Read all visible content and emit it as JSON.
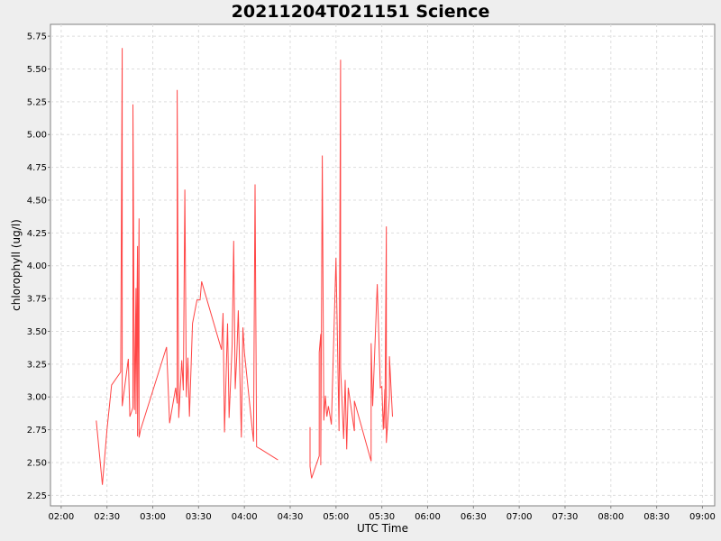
{
  "chart_data": {
    "type": "line",
    "title": "20211204T021151 Science",
    "xlabel": "UTC Time",
    "ylabel": "chlorophyll (ug/l)",
    "x_ticks": [
      "02:00",
      "02:30",
      "03:00",
      "03:30",
      "04:00",
      "04:30",
      "05:00",
      "05:30",
      "06:00",
      "06:30",
      "07:00",
      "07:30",
      "08:00",
      "08:30",
      "09:00"
    ],
    "y_ticks": [
      "2.25",
      "2.50",
      "2.75",
      "3.00",
      "3.25",
      "3.50",
      "3.75",
      "4.00",
      "4.25",
      "4.50",
      "4.75",
      "5.00",
      "5.25",
      "5.50",
      "5.75"
    ],
    "xlim": [
      "01:53",
      "09:08"
    ],
    "ylim": [
      2.17,
      5.84
    ],
    "grid": true,
    "series_color": "#ff4444",
    "series": [
      {
        "segments": [
          [
            [
              "02:23",
              2.82
            ],
            [
              "02:27",
              2.33
            ],
            [
              "02:30",
              2.75
            ],
            [
              "02:33",
              3.09
            ],
            [
              "02:39",
              3.19
            ],
            [
              "02:40",
              5.66
            ],
            [
              "02:40",
              2.93
            ],
            [
              "02:44",
              3.29
            ],
            [
              "02:45",
              2.85
            ],
            [
              "02:47",
              2.92
            ],
            [
              "02:47",
              5.23
            ],
            [
              "02:48",
              2.9
            ],
            [
              "02:49",
              3.83
            ],
            [
              "02:49",
              2.87
            ],
            [
              "02:50",
              4.15
            ],
            [
              "02:50",
              2.7
            ],
            [
              "02:51",
              4.36
            ],
            [
              "02:51",
              2.69
            ],
            [
              "02:52",
              2.75
            ],
            [
              "03:09",
              3.38
            ],
            [
              "03:11",
              2.8
            ],
            [
              "03:15",
              3.07
            ],
            [
              "03:16",
              2.95
            ],
            [
              "03:16",
              5.34
            ],
            [
              "03:17",
              2.84
            ],
            [
              "03:19",
              3.28
            ],
            [
              "03:20",
              3.05
            ],
            [
              "03:21",
              4.58
            ],
            [
              "03:22",
              3.0
            ],
            [
              "03:23",
              3.3
            ],
            [
              "03:24",
              2.85
            ],
            [
              "03:26",
              3.56
            ],
            [
              "03:29",
              3.74
            ],
            [
              "03:31",
              3.74
            ],
            [
              "03:32",
              3.88
            ],
            [
              "03:45",
              3.36
            ],
            [
              "03:46",
              3.64
            ],
            [
              "03:47",
              2.73
            ],
            [
              "03:49",
              3.56
            ],
            [
              "03:50",
              2.84
            ],
            [
              "03:52",
              3.4
            ],
            [
              "03:53",
              4.19
            ],
            [
              "03:54",
              3.06
            ],
            [
              "03:55",
              3.31
            ],
            [
              "03:56",
              3.66
            ],
            [
              "03:58",
              2.69
            ],
            [
              "03:59",
              3.53
            ],
            [
              "04:00",
              3.34
            ],
            [
              "04:06",
              2.66
            ],
            [
              "04:07",
              4.62
            ],
            [
              "04:08",
              2.62
            ],
            [
              "04:11",
              2.6
            ],
            [
              "04:22",
              2.52
            ]
          ],
          [
            [
              "04:43",
              2.77
            ],
            [
              "04:43",
              2.47
            ],
            [
              "04:44",
              2.38
            ],
            [
              "04:49",
              2.55
            ],
            [
              "04:49",
              3.34
            ],
            [
              "04:50",
              3.48
            ],
            [
              "04:50",
              2.48
            ],
            [
              "04:51",
              4.84
            ],
            [
              "04:52",
              2.82
            ],
            [
              "04:53",
              3.01
            ],
            [
              "04:54",
              2.85
            ],
            [
              "04:55",
              2.93
            ],
            [
              "04:57",
              2.79
            ],
            [
              "05:00",
              4.06
            ],
            [
              "05:02",
              2.74
            ],
            [
              "05:03",
              5.57
            ],
            [
              "05:03",
              3.22
            ],
            [
              "05:05",
              2.68
            ],
            [
              "05:06",
              3.13
            ],
            [
              "05:07",
              2.6
            ],
            [
              "05:08",
              3.07
            ],
            [
              "05:12",
              2.74
            ],
            [
              "05:12",
              2.97
            ],
            [
              "05:23",
              2.51
            ],
            [
              "05:23",
              3.41
            ],
            [
              "05:24",
              2.93
            ],
            [
              "05:27",
              3.86
            ],
            [
              "05:29",
              3.07
            ],
            [
              "05:30",
              3.08
            ],
            [
              "05:31",
              2.75
            ],
            [
              "05:32",
              3.06
            ],
            [
              "05:32",
              2.76
            ],
            [
              "05:33",
              4.3
            ],
            [
              "05:33",
              2.65
            ],
            [
              "05:35",
              3.0
            ],
            [
              "05:35",
              3.31
            ],
            [
              "05:37",
              2.85
            ]
          ]
        ]
      }
    ]
  }
}
